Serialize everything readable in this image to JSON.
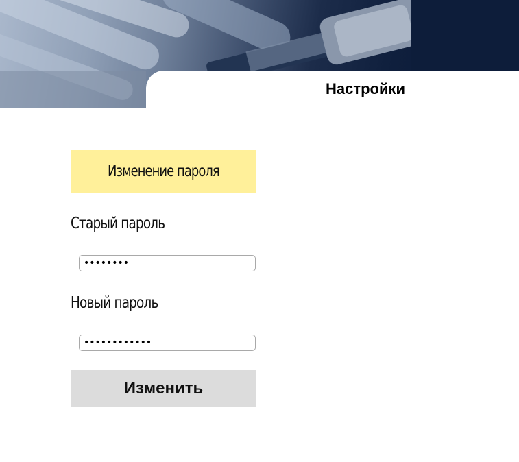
{
  "header": {
    "title": "Настройки"
  },
  "password_form": {
    "section_title": "Изменение пароля",
    "old_password_label": "Старый пароль",
    "old_password_value": "password",
    "new_password_label": "Новый пароль",
    "new_password_value": "newpassword1",
    "submit_label": "Изменить"
  },
  "colors": {
    "section_header_bg": "#fff09a",
    "button_bg": "#dcdcdc",
    "banner_dark": "#0b1a36"
  }
}
